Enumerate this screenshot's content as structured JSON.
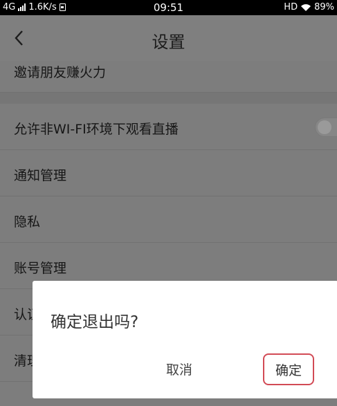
{
  "status_bar": {
    "network": "4G",
    "speed": "1.6K/s",
    "time": "09:51",
    "hd": "HD",
    "battery": "89%"
  },
  "header": {
    "back_icon": "chevron-left-icon",
    "title": "设置"
  },
  "settings": {
    "invite": "邀请朋友赚火力",
    "items": [
      {
        "label": "允许非WI-FI环境下观看直播"
      },
      {
        "label": "通知管理"
      },
      {
        "label": "隐私"
      },
      {
        "label": "账号管理"
      },
      {
        "label": "认证"
      },
      {
        "label": "清理"
      }
    ]
  },
  "dialog": {
    "message": "确定退出吗?",
    "cancel_label": "取消",
    "confirm_label": "确定",
    "confirm_border_color": "#d24a55"
  }
}
